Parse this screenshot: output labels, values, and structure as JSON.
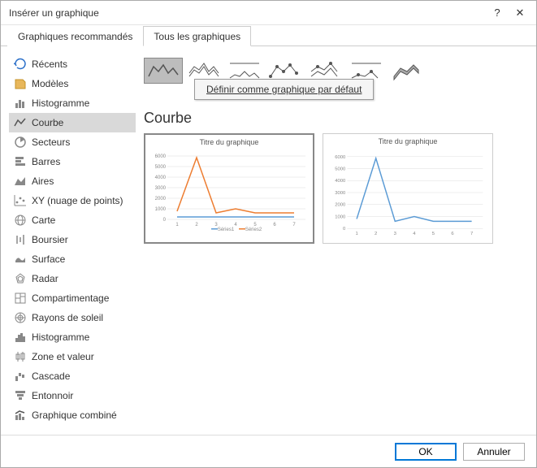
{
  "dialog": {
    "title": "Insérer un graphique",
    "help_label": "?",
    "close_label": "✕"
  },
  "tabs": [
    {
      "label": "Graphiques recommandés",
      "active": false
    },
    {
      "label": "Tous les graphiques",
      "active": true
    }
  ],
  "sidebar": {
    "items": [
      {
        "label": "Récents",
        "icon": "recent-icon"
      },
      {
        "label": "Modèles",
        "icon": "templates-icon"
      },
      {
        "label": "Histogramme",
        "icon": "column-icon"
      },
      {
        "label": "Courbe",
        "icon": "line-icon",
        "active": true
      },
      {
        "label": "Secteurs",
        "icon": "pie-icon"
      },
      {
        "label": "Barres",
        "icon": "bar-icon"
      },
      {
        "label": "Aires",
        "icon": "area-icon"
      },
      {
        "label": "XY (nuage de points)",
        "icon": "scatter-icon"
      },
      {
        "label": "Carte",
        "icon": "map-icon"
      },
      {
        "label": "Boursier",
        "icon": "stock-icon"
      },
      {
        "label": "Surface",
        "icon": "surface-icon"
      },
      {
        "label": "Radar",
        "icon": "radar-icon"
      },
      {
        "label": "Compartimentage",
        "icon": "treemap-icon"
      },
      {
        "label": "Rayons de soleil",
        "icon": "sunburst-icon"
      },
      {
        "label": "Histogramme",
        "icon": "histogram-icon"
      },
      {
        "label": "Zone et valeur",
        "icon": "boxplot-icon"
      },
      {
        "label": "Cascade",
        "icon": "waterfall-icon"
      },
      {
        "label": "Entonnoir",
        "icon": "funnel-icon"
      },
      {
        "label": "Graphique combiné",
        "icon": "combo-icon"
      }
    ]
  },
  "main": {
    "subtypes": [
      "line",
      "stacked-line",
      "percent-stacked-line",
      "line-markers",
      "stacked-line-markers",
      "percent-stacked-line-markers",
      "line-3d"
    ],
    "active_subtype": 0,
    "context_menu": "Définir comme graphique par défaut",
    "chart_title": "Courbe",
    "preview_title": "Titre du graphique",
    "legend_series1": "Séries1",
    "legend_series2": "Séries2"
  },
  "footer": {
    "ok": "OK",
    "cancel": "Annuler"
  },
  "chart_data": [
    {
      "type": "line",
      "title": "Titre du graphique",
      "xlabel": "",
      "ylabel": "",
      "ylim": [
        0,
        6000
      ],
      "x": [
        1,
        2,
        3,
        4,
        5,
        6,
        7
      ],
      "series": [
        {
          "name": "Séries1",
          "color": "#5B9BD5",
          "values": [
            200,
            200,
            200,
            200,
            200,
            200,
            200
          ]
        },
        {
          "name": "Séries2",
          "color": "#ED7D31",
          "values": [
            800,
            5800,
            600,
            1000,
            600,
            600,
            600
          ]
        }
      ]
    },
    {
      "type": "line",
      "title": "Titre du graphique",
      "xlabel": "",
      "ylabel": "",
      "ylim": [
        0,
        6000
      ],
      "x": [
        1,
        2,
        3,
        4,
        5,
        6,
        7
      ],
      "series": [
        {
          "name": "Séries1",
          "color": "#5B9BD5",
          "values": [
            800,
            5800,
            600,
            1000,
            600,
            600,
            600
          ]
        }
      ]
    }
  ]
}
